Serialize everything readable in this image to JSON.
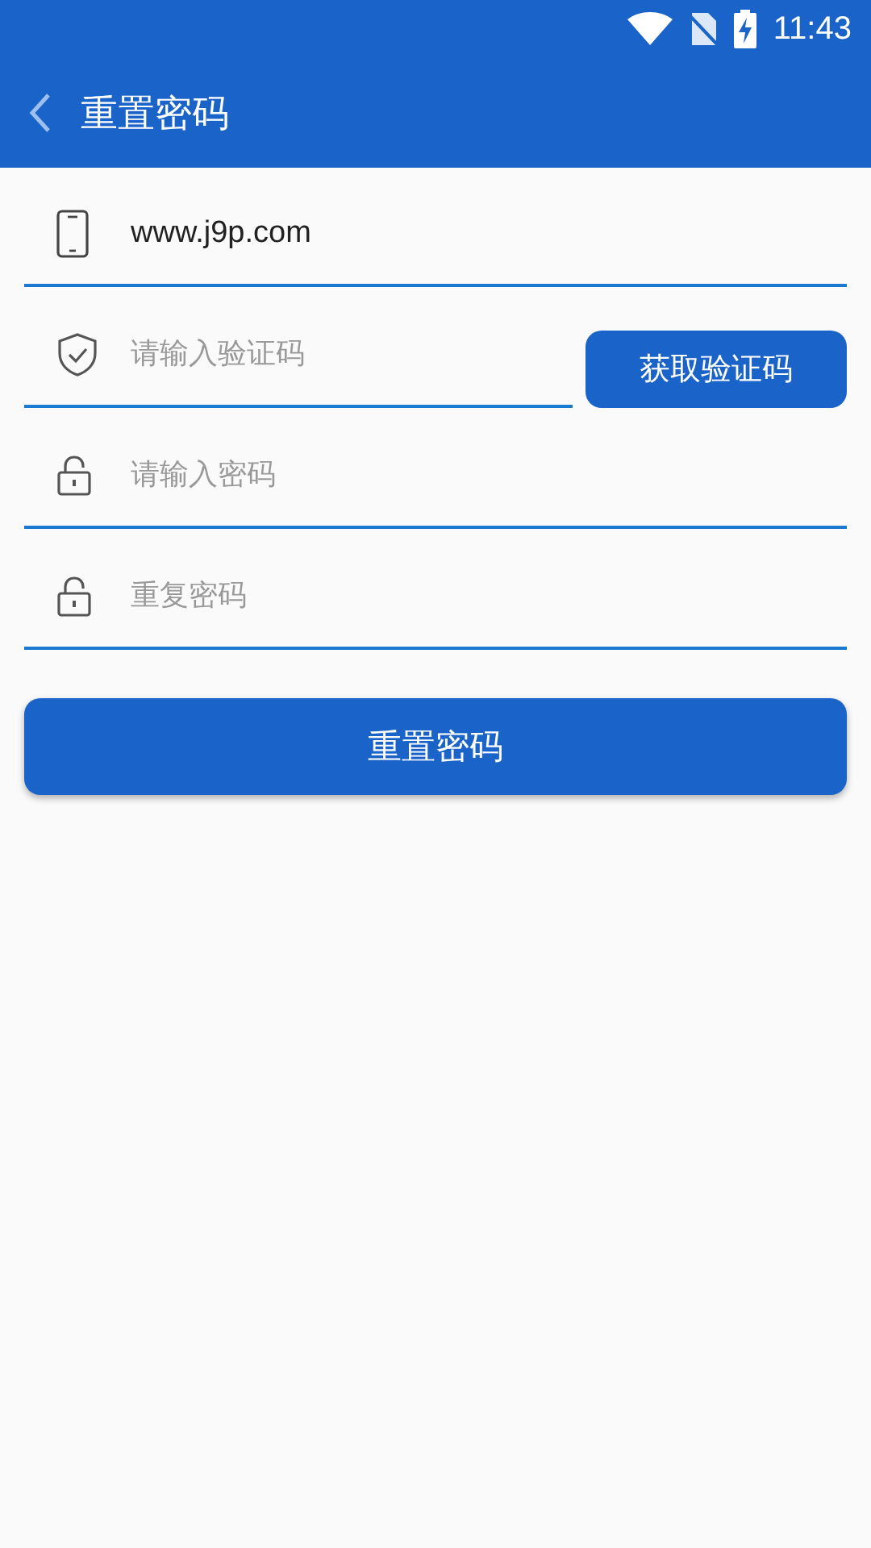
{
  "status_bar": {
    "time": "11:43"
  },
  "app_bar": {
    "title": "重置密码"
  },
  "fields": [
    {
      "kind": "phone",
      "value": "www.j9p.com"
    },
    {
      "kind": "code",
      "placeholder": "请输入验证码",
      "button": "获取验证码"
    },
    {
      "kind": "password",
      "placeholder": "请输入密码"
    },
    {
      "kind": "password",
      "placeholder": "重复密码"
    }
  ],
  "submit": "重置密码"
}
